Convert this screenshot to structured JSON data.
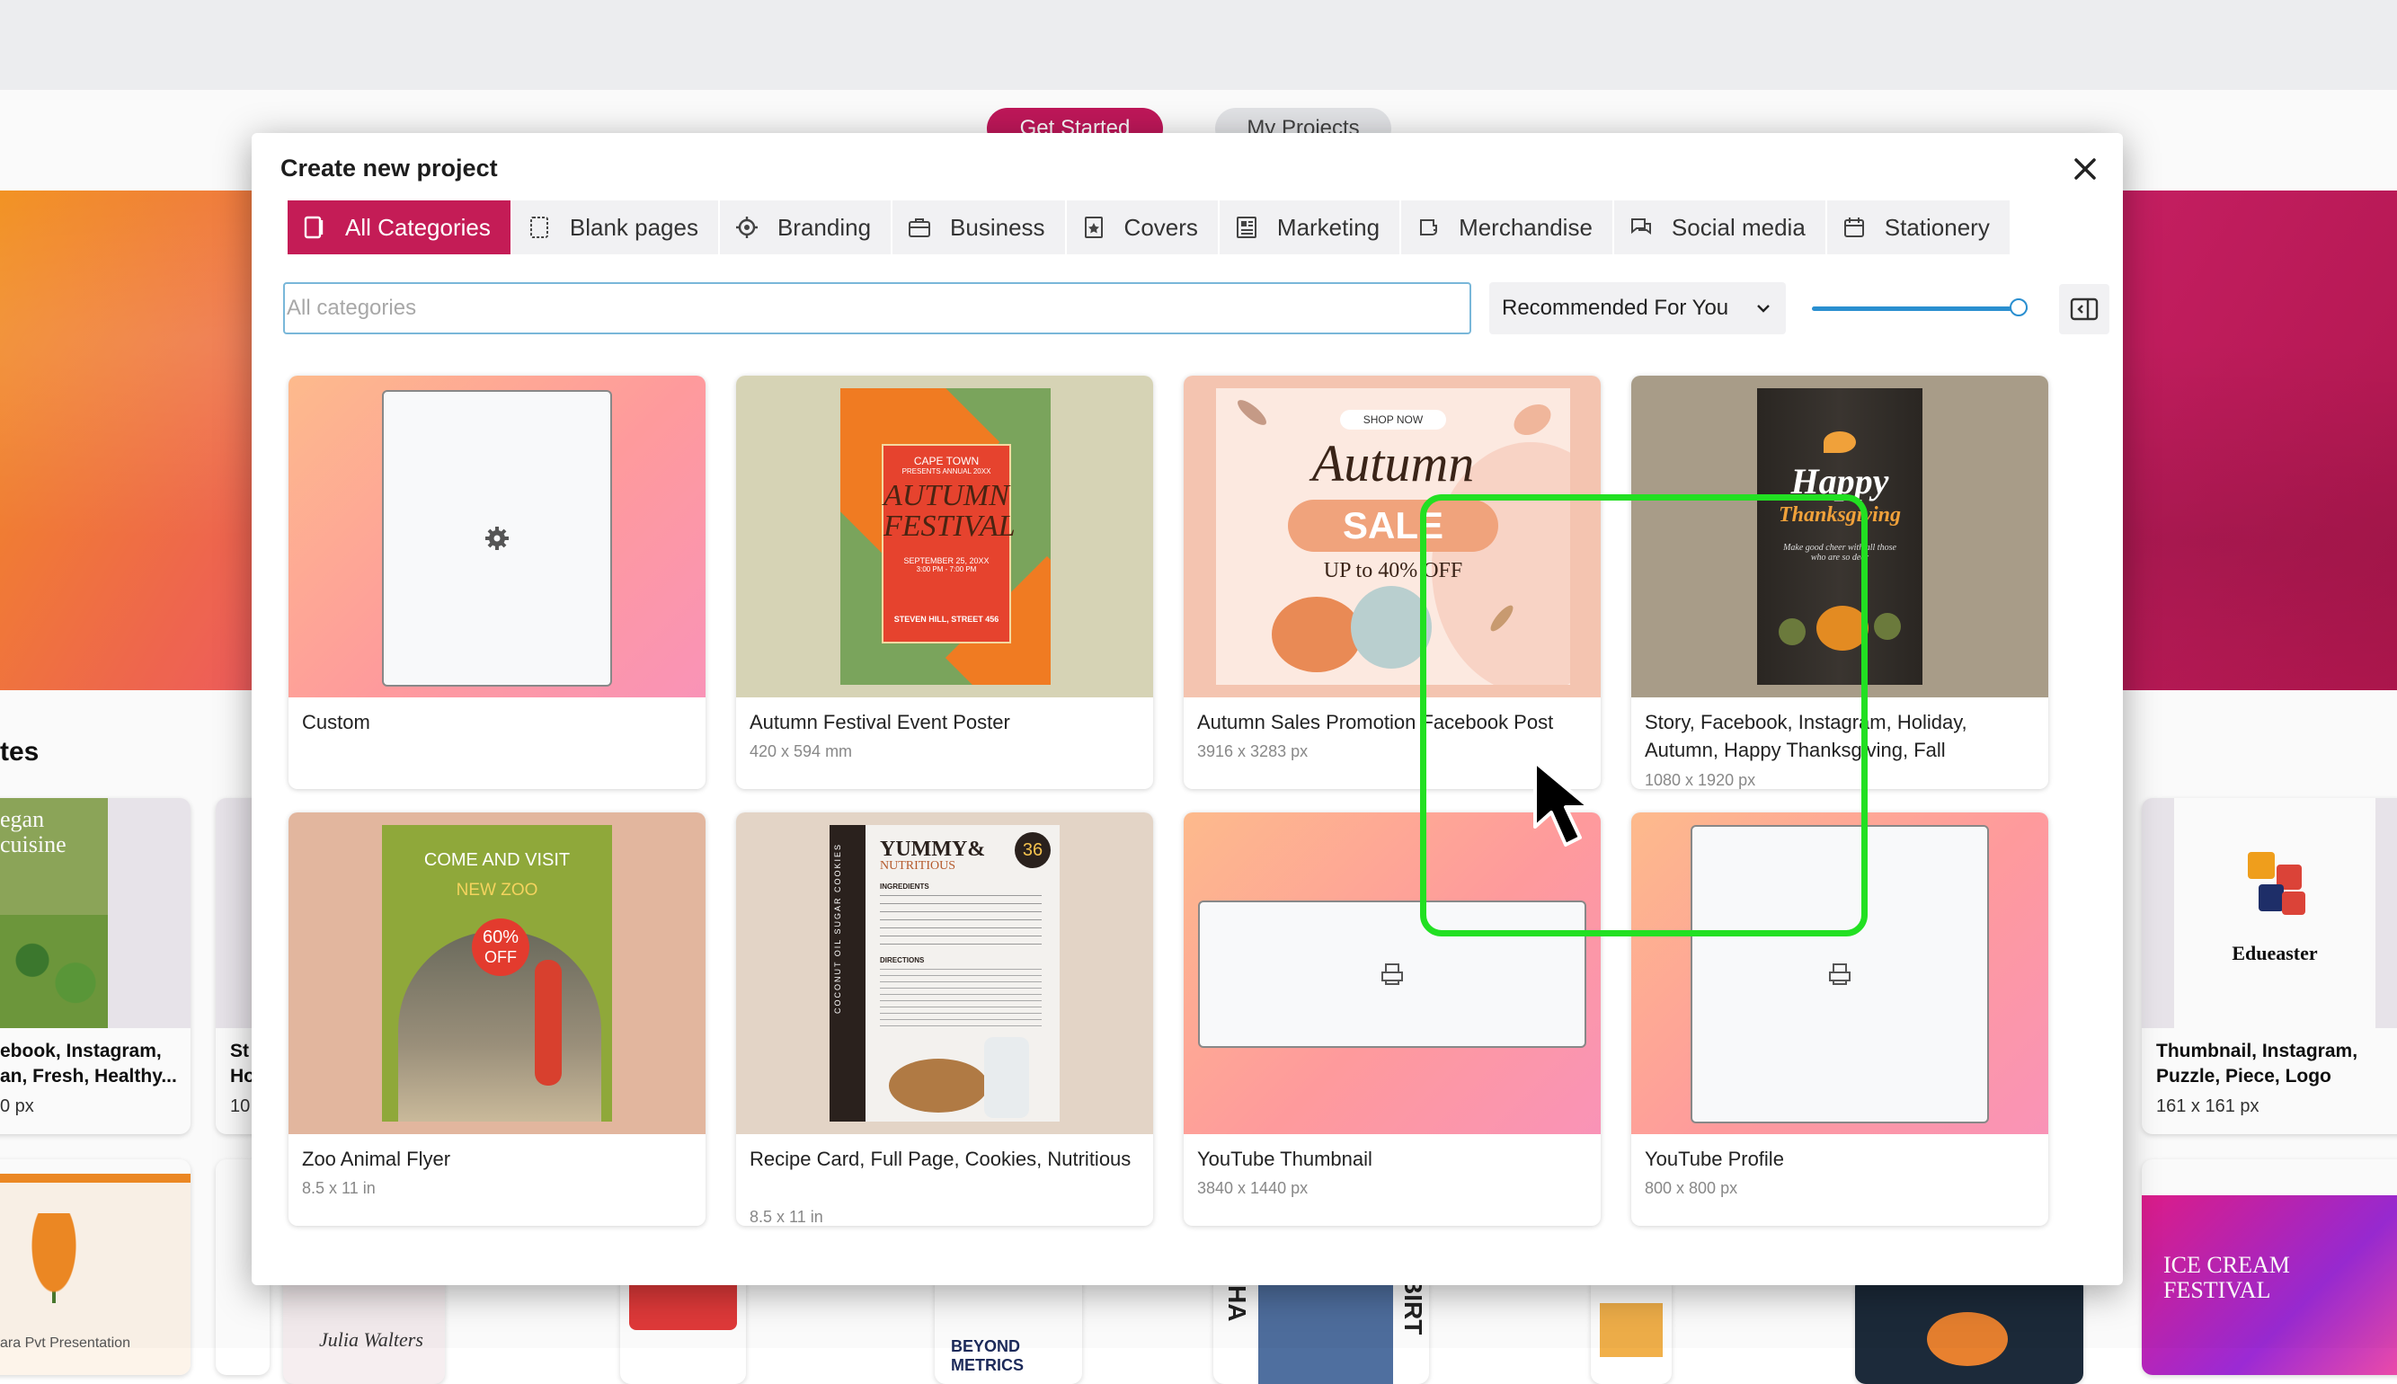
{
  "background": {
    "tabs": [
      "Get Started",
      "My Projects"
    ],
    "section_title": "tes",
    "side_cards": [
      {
        "thumb_text": "egan\ncuisine",
        "line1": "ebook, Instagram,",
        "line2": "an, Fresh, Healthy...",
        "dims": "0 px"
      },
      {
        "line1": "St",
        "line2": "Ho",
        "dims": "10"
      },
      {
        "thumb_text": "Edueaster",
        "line1": "Thumbnail, Instagram,",
        "line2": "Puzzle, Piece, Logo",
        "dims": "161 x 161 px"
      }
    ],
    "bottom_texts": [
      "ara Pvt Presentation",
      "Julia Walters",
      "BEYOND METRICS",
      "HA",
      "BIRT",
      "ICE CREAM FESTIVAL"
    ]
  },
  "modal": {
    "title": "Create new project",
    "close_icon": "close-icon",
    "tabs": [
      {
        "label": "All Categories",
        "icon": "categories-icon",
        "active": true
      },
      {
        "label": "Blank pages",
        "icon": "blank-page-icon",
        "active": false
      },
      {
        "label": "Branding",
        "icon": "branding-icon",
        "active": false
      },
      {
        "label": "Business",
        "icon": "briefcase-icon",
        "active": false
      },
      {
        "label": "Covers",
        "icon": "cover-icon",
        "active": false
      },
      {
        "label": "Marketing",
        "icon": "marketing-icon",
        "active": false
      },
      {
        "label": "Merchandise",
        "icon": "merchandise-icon",
        "active": false
      },
      {
        "label": "Social media",
        "icon": "social-media-icon",
        "active": false
      },
      {
        "label": "Stationery",
        "icon": "stationery-icon",
        "active": false
      }
    ],
    "search": {
      "placeholder": "All categories",
      "value": ""
    },
    "sort": {
      "selected": "Recommended For You"
    },
    "zoom_slider": {
      "value": 1.0
    },
    "cards": [
      {
        "title": "Custom",
        "dims": ""
      },
      {
        "title": "Autumn Festival Event Poster",
        "dims": "420 x 594 mm",
        "poster": {
          "line1": "CAPE TOWN",
          "line2": "PRESENTS ANNUAL 20XX",
          "line3": "AUTUMN",
          "line4": "FESTIVAL",
          "line5": "SEPTEMBER 25, 20XX",
          "line6": "3:00 PM - 7:00 PM",
          "line7": "STEVEN HILL, STREET 456"
        }
      },
      {
        "title": "Autumn Sales Promotion Facebook Post",
        "dims": "3916 x 3283 px",
        "poster": {
          "shop": "SHOP NOW",
          "script": "Autumn",
          "sale": "SALE",
          "offer": "UP to 40% OFF"
        }
      },
      {
        "title": "Story, Facebook, Instagram, Holiday, Autumn, Happy Thanksgiving, Fall",
        "dims": "1080 x 1920 px",
        "poster": {
          "line1": "Happy",
          "line2": "Thanksgiving",
          "line3": "Make good cheer with all those who are so dear"
        }
      },
      {
        "title": "Zoo Animal Flyer",
        "dims": "8.5 x 11 in",
        "poster": {
          "line1": "COME AND VISIT",
          "line2": "NEW ZOO",
          "pct": "60%",
          "off": "OFF"
        }
      },
      {
        "title": "Recipe Card, Full Page, Cookies, Nutritious",
        "dims": "8.5 x 11 in",
        "poster": {
          "line1": "YUMMY&",
          "line2": "NUTRITIOUS",
          "badge": "36",
          "side": "COCONUT OIL SUGAR COOKIES",
          "ing": "INGREDIENTS",
          "dir": "DIRECTIONS"
        }
      },
      {
        "title": "YouTube Thumbnail",
        "dims": "3840 x 1440 px"
      },
      {
        "title": "YouTube Profile",
        "dims": "800 x 800 px"
      }
    ]
  },
  "colors": {
    "accent": "#c41c56",
    "highlight": "#22e022",
    "link": "#2a8fd0"
  }
}
